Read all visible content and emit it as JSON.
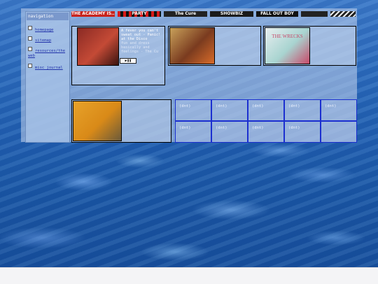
{
  "nav": {
    "title": "navigation",
    "items": [
      {
        "label": "homepage"
      },
      {
        "label": "sitemap"
      },
      {
        "label": "resources/the web"
      },
      {
        "label": "misc_journal"
      }
    ]
  },
  "banners": [
    {
      "text": "THE ACADEMY IS...",
      "bg": "#c8231c",
      "fg": "#ffffff"
    },
    {
      "text": "PARTY",
      "bg": "#d81a1a",
      "fg": "#ffffff"
    },
    {
      "text": "The Cure",
      "bg": "#222222",
      "fg": "#ffffff"
    },
    {
      "text": "SHOWBIZ",
      "bg": "#1a1a1a",
      "fg": "#ffffff"
    },
    {
      "text": "FALL OUT BOY",
      "bg": "#111111",
      "fg": "#ffffff"
    },
    {
      "text": "",
      "bg": "#222222",
      "fg": "#ffffff"
    },
    {
      "text": "",
      "bg": "#333333",
      "fg": "#ffffff"
    }
  ],
  "albums": [
    {
      "art_colors": [
        "#8a2a24",
        "#c44a36",
        "#3b1410"
      ]
    },
    {
      "art_colors": [
        "#c8a15a",
        "#7a3b1f",
        "#d86b2a"
      ]
    },
    {
      "art_colors": [
        "#e8eef0",
        "#a8d4d0",
        "#c84a6a"
      ],
      "art_text": "THE WRECKS"
    },
    {
      "art_colors": [
        "#e7a22a",
        "#d98a18",
        "#6b5a3a"
      ]
    }
  ],
  "now_playing": {
    "line1": "A fever you can't",
    "line2": "sweat out - Panic!",
    "line3": "at the Disco",
    "line4": "fun and dress",
    "line5": "basically and",
    "line6": "feelings - The Cu",
    "controls": "▶❚❚"
  },
  "grid_cells": [
    "(dnt)",
    "(dnt)",
    "(dnt)",
    "(dnt)",
    "(dnt)",
    "(dnt)",
    "(dnt)",
    "(dnt)",
    "(dnt)"
  ],
  "colors": {
    "link": "#2233aa",
    "cell_border": "#1b2fd0"
  }
}
